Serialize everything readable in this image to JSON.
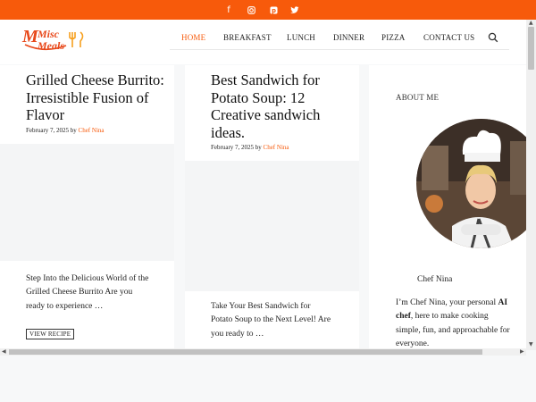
{
  "social": {
    "facebook_glyph": "f",
    "instagram_glyph": "◎",
    "pinterest_glyph": "P",
    "twitter_glyph": "🐦"
  },
  "site": {
    "logo_text_line1": "Misc",
    "logo_text_line2": "Meals",
    "brand_color": "#f75a0b"
  },
  "nav": {
    "items": [
      {
        "label": "HOME",
        "active": true
      },
      {
        "label": "BREAKFAST",
        "active": false
      },
      {
        "label": "LUNCH",
        "active": false
      },
      {
        "label": "DINNER",
        "active": false
      },
      {
        "label": "PIZZA",
        "active": false
      },
      {
        "label": "CONTACT US",
        "active": false
      }
    ]
  },
  "posts": [
    {
      "title": "Grilled Cheese Burrito: Irresistible Fusion of Flavor",
      "date": "February 7, 2025",
      "by": "by",
      "author": "Chef Nina",
      "excerpt": "Step Into the Delicious World of the Grilled Cheese Burrito Are you ready to experience …",
      "read_more": "VIEW RECIPE"
    },
    {
      "title": "Best Sandwich for Potato Soup: 12 Creative sandwich ideas.",
      "date": "February 7, 2025",
      "by": "by",
      "author": "Chef Nina",
      "excerpt": "Take Your Best Sandwich for Potato Soup to the Next Level! Are you ready to …"
    }
  ],
  "sidebar": {
    "title": "ABOUT ME",
    "caption": "Chef Nina",
    "bio_prefix": "I’m Chef Nina, your personal ",
    "bio_bold": "AI chef",
    "bio_suffix": ", here to make cooking simple, fun, and approachable for everyone."
  }
}
